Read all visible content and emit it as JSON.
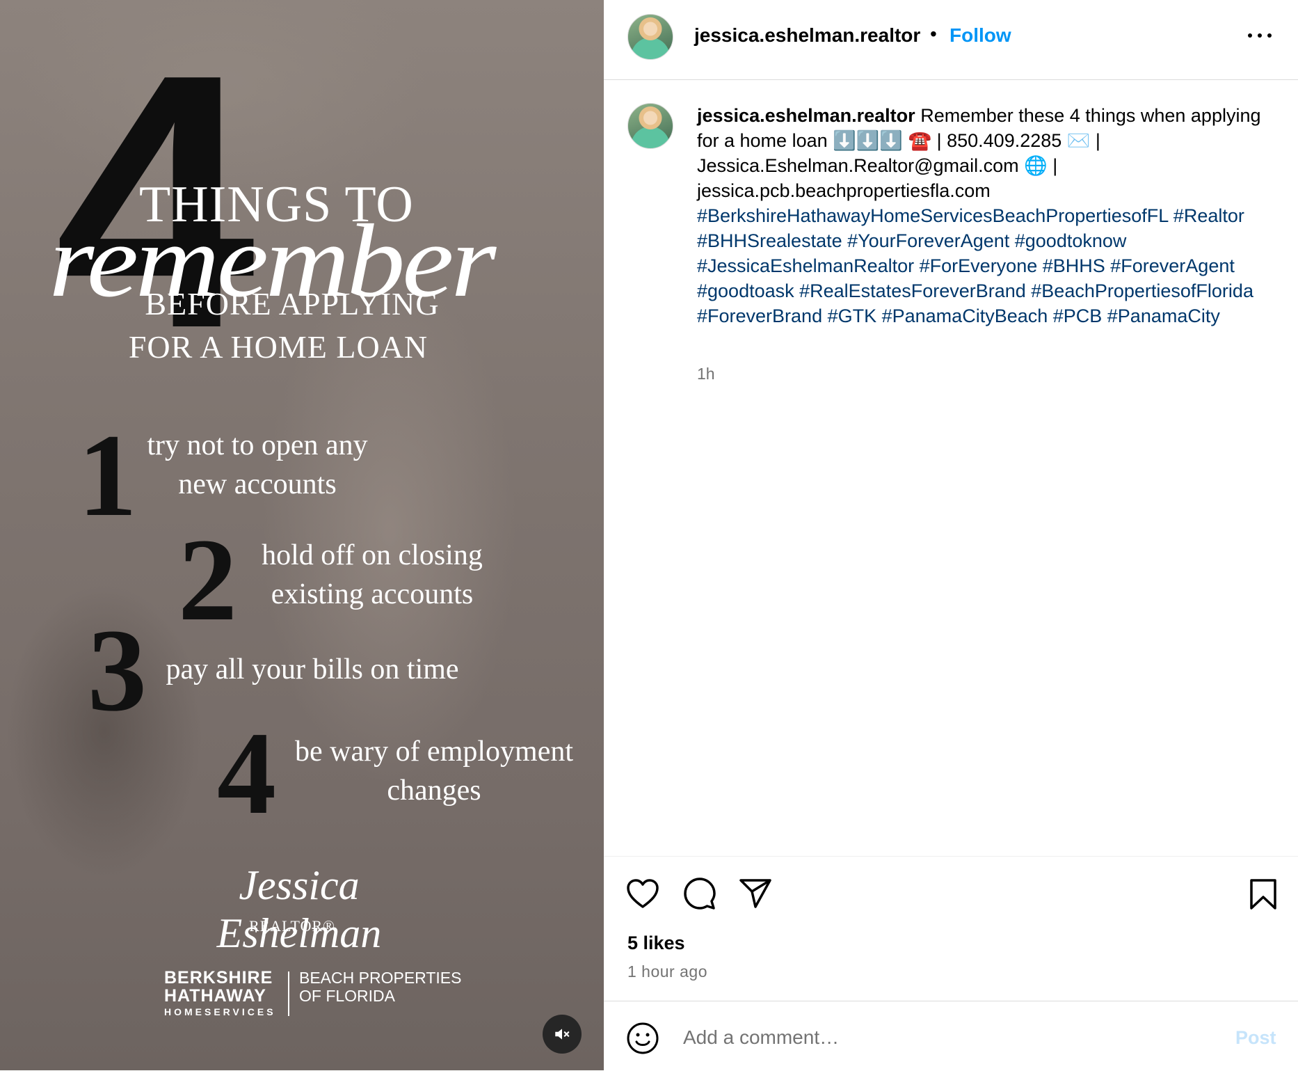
{
  "media": {
    "big_number": "4",
    "title_line1": "THINGS TO",
    "title_script": "remember",
    "subtitle_line1": "BEFORE APPLYING",
    "subtitle_line2": "FOR A HOME LOAN",
    "tips": [
      {
        "num": "1",
        "line1": "try not to open any",
        "line2": "new accounts"
      },
      {
        "num": "2",
        "line1": "hold off on closing",
        "line2": "existing accounts"
      },
      {
        "num": "3",
        "line1": "pay all your bills on time",
        "line2": ""
      },
      {
        "num": "4",
        "line1": "be wary of employment",
        "line2": "changes"
      }
    ],
    "signature": "Jessica Eshelman",
    "realtor": "REALTOR®",
    "brand_left_line1": "BERKSHIRE",
    "brand_left_line2": "HATHAWAY",
    "brand_left_sub": "HOMESERVICES",
    "brand_right_line1": "BEACH PROPERTIES",
    "brand_right_line2": "OF FLORIDA",
    "mute_icon": "speaker-muted-icon"
  },
  "header": {
    "username": "jessica.eshelman.realtor",
    "separator": "•",
    "follow_label": "Follow",
    "more_icon": "more-options-icon"
  },
  "caption": {
    "username": "jessica.eshelman.realtor",
    "text": "Remember these 4 things when applying for a home loan ⬇️⬇️⬇️ ☎️ | 850.409.2285 ✉️ | Jessica.Eshelman.Realtor@gmail.com 🌐 | jessica.pcb.beachpropertiesfla.com",
    "hashtags": "#BerkshireHathawayHomeServicesBeachPropertiesofFL #Realtor #BHHSrealestate #YourForeverAgent #goodtoknow #JessicaEshelmanRealtor #ForEveryone #BHHS #ForeverAgent #goodtoask #RealEstatesForeverBrand #BeachPropertiesofFlorida #ForeverBrand #GTK #PanamaCityBeach #PCB #PanamaCity",
    "time": "1h"
  },
  "actions": {
    "like_icon": "heart-icon",
    "comment_icon": "comment-icon",
    "share_icon": "share-icon",
    "save_icon": "bookmark-icon"
  },
  "stats": {
    "likes": "5 likes",
    "posted_ago": "1 hour ago"
  },
  "comment": {
    "emoji_icon": "emoji-icon",
    "placeholder": "Add a comment…",
    "post_label": "Post"
  },
  "colors": {
    "follow_blue": "#0095f6",
    "hashtag_blue": "#00376b",
    "post_disabled": "#c6e4fb",
    "secondary_text": "#737373"
  }
}
